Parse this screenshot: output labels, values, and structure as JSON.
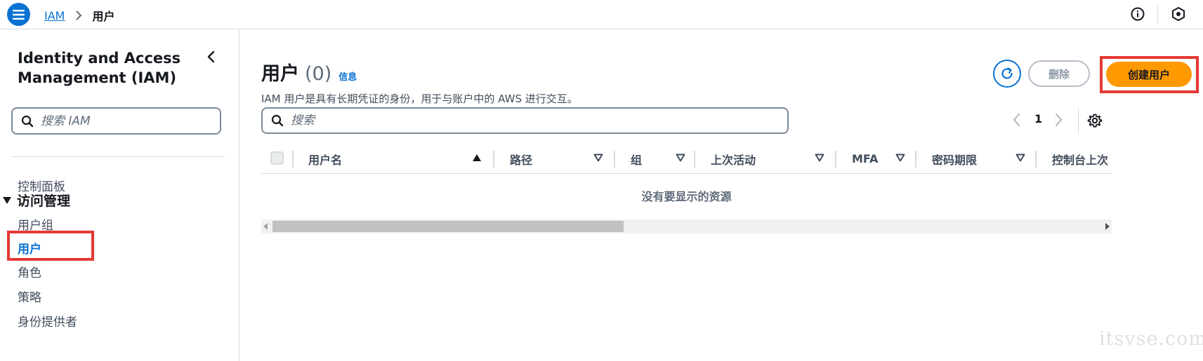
{
  "topbar": {
    "breadcrumb_root": "IAM",
    "breadcrumb_current": "用户"
  },
  "sidebar": {
    "title": "Identity and Access Management (IAM)",
    "search_placeholder": "搜索 IAM",
    "dashboard": "控制面板",
    "section_access": "访问管理",
    "items": [
      {
        "label": "用户组",
        "active": false
      },
      {
        "label": "用户",
        "active": true
      },
      {
        "label": "角色",
        "active": false
      },
      {
        "label": "策略",
        "active": false
      },
      {
        "label": "身份提供者",
        "active": false
      }
    ]
  },
  "main": {
    "title": "用户",
    "count": "(0)",
    "info_link": "信息",
    "description": "IAM 用户是具有长期凭证的身份，用于与账户中的 AWS 进行交互。",
    "delete_label": "删除",
    "create_label": "创建用户",
    "search_placeholder": "搜索",
    "page_number": "1",
    "columns": [
      "用户名",
      "路径",
      "组",
      "上次活动",
      "MFA",
      "密码期限",
      "控制台上次"
    ],
    "empty_message": "没有要显示的资源"
  },
  "colors": {
    "primary": "#0972d3",
    "accent": "#ff9900",
    "highlight": "#e53935"
  },
  "watermark": "itsvse.com"
}
